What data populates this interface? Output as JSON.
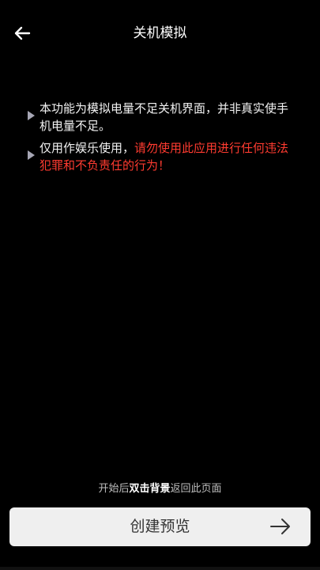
{
  "header": {
    "title": "关机模拟",
    "back_icon": "arrow-left-icon"
  },
  "notes": [
    {
      "text": "本功能为模拟电量不足关机界面，并非真实使手机电量不足。"
    },
    {
      "text": "仅用作娱乐使用，",
      "warning": "请勿使用此应用进行任何违法犯罪和不负责任的行为！"
    }
  ],
  "hint": {
    "prefix": "开始后",
    "bold": "双击背景",
    "suffix": "返回此页面"
  },
  "preview_button": {
    "label": "创建预览",
    "icon": "arrow-right-icon"
  },
  "colors": {
    "background": "#000000",
    "warning": "#ff3b30",
    "button_bg": "#efefef",
    "bullet": "#a6a6b4"
  }
}
